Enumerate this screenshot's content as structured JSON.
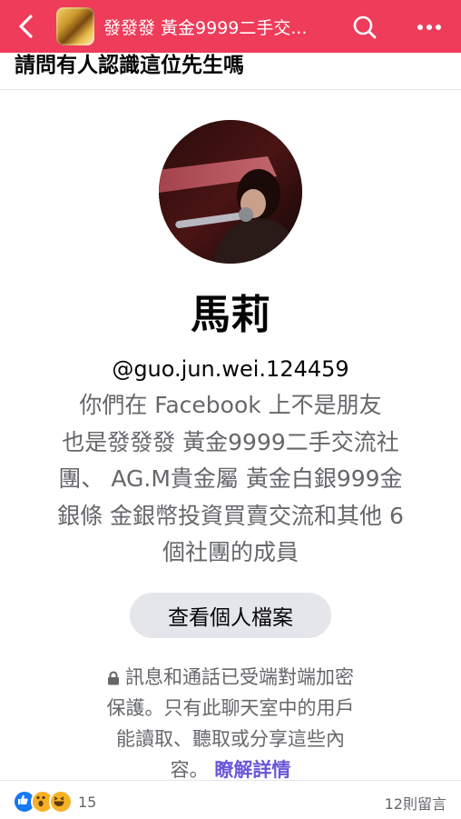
{
  "topbar": {
    "title": "發發發 黃金9999二手交...",
    "colors": {
      "bar": "#ee3c5a",
      "text": "#ffffff"
    },
    "icons": [
      "back-arrow-icon",
      "group-thumbnail",
      "search-icon",
      "more-icon"
    ]
  },
  "post": {
    "title": "請問有人認識這位先生嗎"
  },
  "profile": {
    "name": "馬莉",
    "username": "@guo.jun.wei.124459",
    "info_lines": [
      "你們在 Facebook 上不是朋友",
      "也是發發發 黃金9999二手交流社",
      "團、 AG.M貴金屬 黃金白銀999金",
      "銀條 金銀幣投資買賣交流和其他 6",
      "個社團的成員"
    ],
    "view_profile_label": "查看個人檔案",
    "e2e_lines": [
      "訊息和通話已受端對端加密",
      "保護。只有此聊天室中的用戶",
      "能讀取、聽取或分享這些內",
      "容。"
    ],
    "learn_more_label": "瞭解詳情"
  },
  "footer": {
    "reaction_count": "15",
    "comments_label": "12則留言",
    "reaction_icons": [
      "like-icon",
      "wow-icon",
      "haha-icon"
    ]
  }
}
